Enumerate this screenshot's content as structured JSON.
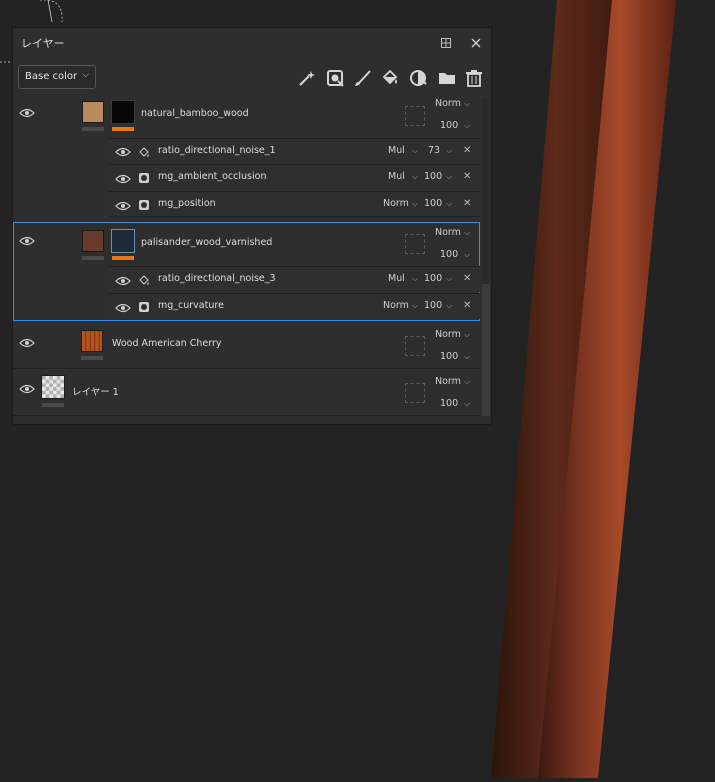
{
  "panel": {
    "title": "レイヤー",
    "channel": "Base color"
  },
  "toolbar": {
    "tools": [
      "magic-wand-icon",
      "smart-material-icon",
      "paint-brush-icon",
      "fill-bucket-icon",
      "smart-mask-icon",
      "folder-icon",
      "trash-icon"
    ]
  },
  "colors": {
    "accent": "#e6771c",
    "selection": "#3f8be0"
  },
  "layers": [
    {
      "name": "natural_bamboo_wood",
      "blend": "Norm",
      "opacity": "100",
      "effects": [
        {
          "name": "ratio_directional_noise_1",
          "blend": "Mul",
          "opacity": "73"
        },
        {
          "name": "mg_ambient_occlusion",
          "blend": "Mul",
          "opacity": "100"
        },
        {
          "name": "mg_position",
          "blend": "Norm",
          "opacity": "100"
        }
      ]
    },
    {
      "name": "palisander_wood_varnished",
      "blend": "Norm",
      "opacity": "100",
      "effects": [
        {
          "name": "ratio_directional_noise_3",
          "blend": "Mul",
          "opacity": "100"
        },
        {
          "name": "mg_curvature",
          "blend": "Norm",
          "opacity": "100"
        }
      ]
    },
    {
      "name": "Wood American Cherry",
      "blend": "Norm",
      "opacity": "100"
    },
    {
      "name": "レイヤー 1",
      "blend": "Norm",
      "opacity": "100"
    }
  ]
}
